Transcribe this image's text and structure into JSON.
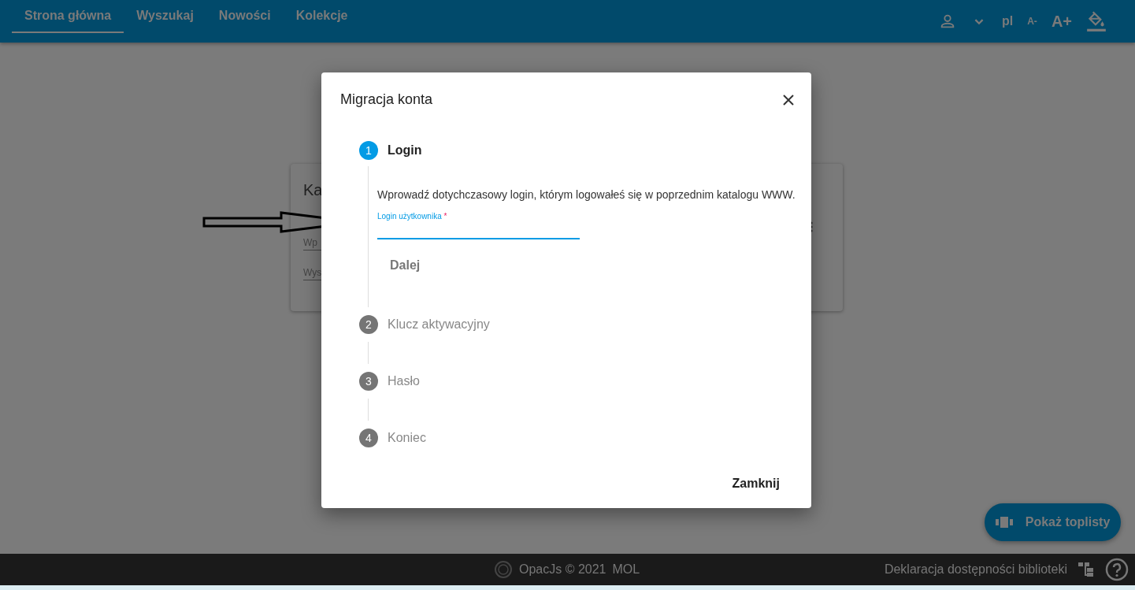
{
  "nav": {
    "tabs": [
      {
        "label": "Strona główna",
        "selected": true
      },
      {
        "label": "Wyszukaj",
        "selected": false
      },
      {
        "label": "Nowości",
        "selected": false
      },
      {
        "label": "Kolekcje",
        "selected": false
      }
    ],
    "language": "pl",
    "font_smaller": "A-",
    "font_larger": "A+"
  },
  "background_card": {
    "title": "Ka",
    "field_1": "Wp",
    "field_2": "Wys"
  },
  "dialog": {
    "title": "Migracja konta",
    "steps": [
      {
        "number": "1",
        "label": "Login",
        "selected": true,
        "description": "Wprowadź dotychczasowy login, którym logowałeś się w poprzednim katalogu WWW.",
        "field_label": "Login użytkownika",
        "required_mark": "*",
        "next_button": "Dalej"
      },
      {
        "number": "2",
        "label": "Klucz aktywacyjny",
        "selected": false
      },
      {
        "number": "3",
        "label": "Hasło",
        "selected": false
      },
      {
        "number": "4",
        "label": "Koniec",
        "selected": false
      }
    ],
    "close_button": "Zamknij"
  },
  "toplist_button": "Pokaż toplisty",
  "footer": {
    "copyright": "OpacJs © 2021",
    "vendor": "MOL",
    "accessibility_link": "Deklaracja dostępności biblioteki"
  }
}
